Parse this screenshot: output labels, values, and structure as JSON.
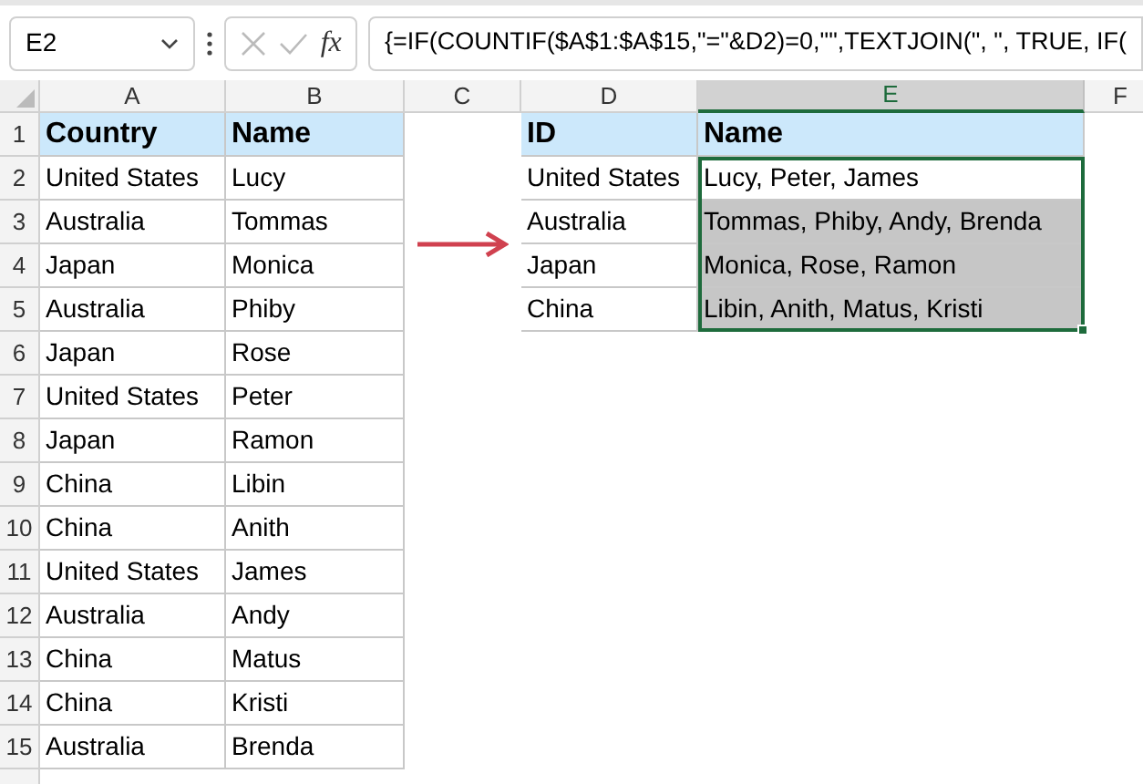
{
  "name_box": {
    "value": "E2"
  },
  "formula_bar": {
    "fx": "fx",
    "value": "{=IF(COUNTIF($A$1:$A$15,\"=\"&D2)=0,\"\",TEXTJOIN(\", \", TRUE, IF("
  },
  "columns": [
    {
      "label": "A",
      "selected": false
    },
    {
      "label": "B",
      "selected": false
    },
    {
      "label": "C",
      "selected": false
    },
    {
      "label": "D",
      "selected": false
    },
    {
      "label": "E",
      "selected": true
    },
    {
      "label": "F",
      "selected": false
    }
  ],
  "row_numbers": [
    "1",
    "2",
    "3",
    "4",
    "5",
    "6",
    "7",
    "8",
    "9",
    "10",
    "11",
    "12",
    "13",
    "14",
    "15"
  ],
  "left_table": {
    "header": [
      "Country",
      "Name"
    ],
    "rows": [
      [
        "United States",
        "Lucy"
      ],
      [
        "Australia",
        "Tommas"
      ],
      [
        "Japan",
        "Monica"
      ],
      [
        "Australia",
        "Phiby"
      ],
      [
        "Japan",
        "Rose"
      ],
      [
        "United States",
        "Peter"
      ],
      [
        "Japan",
        "Ramon"
      ],
      [
        "China",
        "Libin"
      ],
      [
        "China",
        "Anith"
      ],
      [
        "United States",
        "James"
      ],
      [
        "Australia",
        "Andy"
      ],
      [
        "China",
        "Matus"
      ],
      [
        "China",
        "Kristi"
      ],
      [
        "Australia",
        "Brenda"
      ]
    ]
  },
  "right_table": {
    "header": [
      "ID",
      "Name"
    ],
    "rows": [
      {
        "id": "United States",
        "names": "Lucy, Peter, James",
        "highlighted": false
      },
      {
        "id": "Australia",
        "names": "Tommas, Phiby, Andy, Brenda",
        "highlighted": true
      },
      {
        "id": "Japan",
        "names": "Monica, Rose, Ramon",
        "highlighted": true
      },
      {
        "id": "China",
        "names": "Libin, Anith, Matus, Kristi",
        "highlighted": true
      }
    ]
  }
}
